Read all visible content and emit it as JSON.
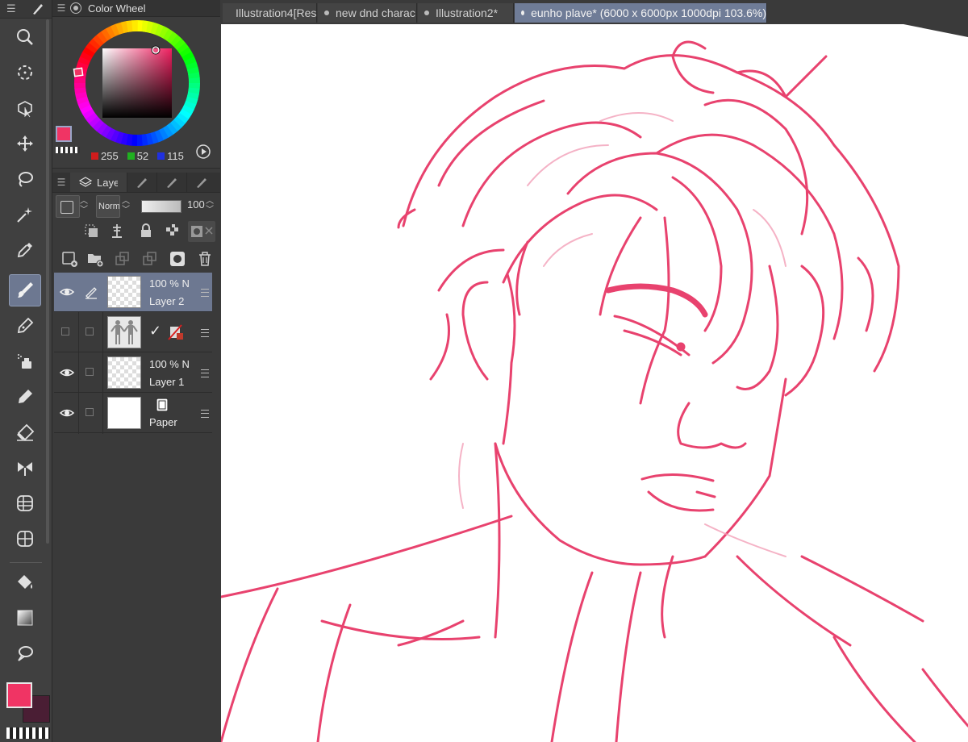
{
  "tabs": [
    {
      "label": "Illustration4[Res",
      "active": false
    },
    {
      "label": "new dnd charac",
      "active": false
    },
    {
      "label": "Illustration2*",
      "active": false
    },
    {
      "label": "eunho plave* (6000 x 6000px 1000dpi 103.6%)",
      "active": true
    }
  ],
  "color_panel": {
    "title": "Color Wheel",
    "current_color": "#f03464",
    "r": "255",
    "g": "52",
    "b": "115"
  },
  "layer_panel": {
    "tab_label": "Layer",
    "blend_mode": "Norm",
    "opacity_value": "100",
    "layers": [
      {
        "opacity": "100 % N",
        "name": "Layer 2",
        "visible": true,
        "selected": true
      },
      {
        "opacity": "",
        "name": "",
        "visible": false,
        "selected": false
      },
      {
        "opacity": "100 % N",
        "name": "Layer 1",
        "visible": true,
        "selected": false
      },
      {
        "opacity": "",
        "name": "Paper",
        "visible": true,
        "selected": false
      }
    ]
  },
  "colors": {
    "ink": "#e8426e",
    "accent": "#6d7891",
    "fg": "#f03464",
    "bg": "#4a1e34"
  },
  "tools": [
    "menu-icon",
    "pen-icon",
    "zoom-icon",
    "rotate-icon",
    "object-select-icon",
    "move-icon",
    "lasso-icon",
    "magic-wand-icon",
    "eyedropper-icon",
    "brush-icon",
    "pen-tool-icon",
    "airbrush-icon",
    "decoration-icon",
    "eraser-icon",
    "blend-icon",
    "figure-icon",
    "frame-icon",
    "fill-icon",
    "gradient-icon",
    "balloon-icon"
  ]
}
